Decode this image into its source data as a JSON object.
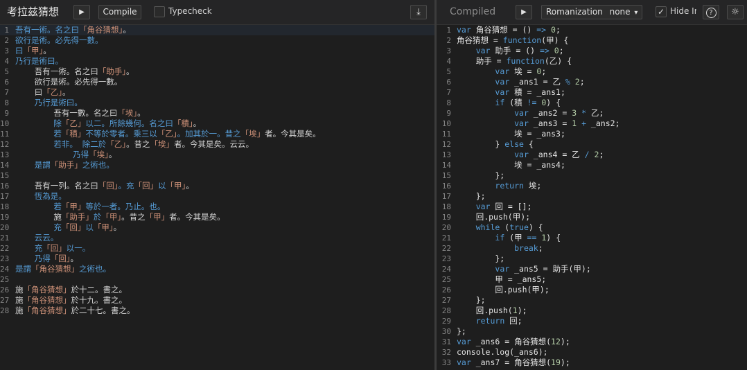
{
  "left": {
    "title": "考拉兹猜想",
    "compile_label": "Compile",
    "typecheck_label": "Typecheck",
    "lines": [
      [
        [
          "吾有一術。名之曰",
          "wy-kw"
        ],
        [
          "「角谷猜想」",
          "wy-str"
        ],
        [
          "。",
          "wy-id"
        ]
      ],
      [
        [
          "欲行是術。必先得一數。",
          "wy-kw"
        ]
      ],
      [
        [
          "曰",
          "wy-kw"
        ],
        [
          "「甲」",
          "wy-str"
        ],
        [
          "。",
          "wy-id"
        ]
      ],
      [
        [
          "乃行是術曰。",
          "wy-kw"
        ]
      ],
      [
        [
          "    吾有一術。名之曰",
          "wy-id"
        ],
        [
          "「助手」",
          "wy-str"
        ],
        [
          "。",
          "wy-id"
        ]
      ],
      [
        [
          "    欲行是術。必先得一數。",
          "wy-id"
        ]
      ],
      [
        [
          "    曰",
          "wy-id"
        ],
        [
          "「乙」",
          "wy-str"
        ],
        [
          "。",
          "wy-id"
        ]
      ],
      [
        [
          "    乃行是術曰。",
          "wy-kw"
        ]
      ],
      [
        [
          "        吾有一數。名之曰",
          "wy-id"
        ],
        [
          "「埃」",
          "wy-str"
        ],
        [
          "。",
          "wy-id"
        ]
      ],
      [
        [
          "        除",
          "wy-kw"
        ],
        [
          "「乙」",
          "wy-str"
        ],
        [
          "以二。所餘幾何。名之曰",
          "wy-kw"
        ],
        [
          "「積」",
          "wy-str"
        ],
        [
          "。",
          "wy-id"
        ]
      ],
      [
        [
          "        若",
          "wy-kw"
        ],
        [
          "「積」",
          "wy-str"
        ],
        [
          "不等於零者。乘三以",
          "wy-kw"
        ],
        [
          "「乙」",
          "wy-str"
        ],
        [
          "。加其於一。昔之",
          "wy-kw"
        ],
        [
          "「埃」",
          "wy-str"
        ],
        [
          "者。今其是矣。",
          "wy-id"
        ]
      ],
      [
        [
          "        若非。 除二於",
          "wy-kw"
        ],
        [
          "「乙」",
          "wy-str"
        ],
        [
          "。昔之",
          "wy-id"
        ],
        [
          "「埃」",
          "wy-str"
        ],
        [
          "者。今其是矣。云云。",
          "wy-id"
        ]
      ],
      [
        [
          "            乃得",
          "wy-kw"
        ],
        [
          "「埃」",
          "wy-str"
        ],
        [
          "。",
          "wy-id"
        ]
      ],
      [
        [
          "    是謂",
          "wy-kw"
        ],
        [
          "「助手」",
          "wy-str"
        ],
        [
          "之術也。",
          "wy-kw"
        ]
      ],
      [
        [
          "",
          "wy-id"
        ]
      ],
      [
        [
          "    吾有一列。名之曰",
          "wy-id"
        ],
        [
          "「回」",
          "wy-str"
        ],
        [
          "。充",
          "wy-kw"
        ],
        [
          "「回」",
          "wy-str"
        ],
        [
          "以",
          "wy-kw"
        ],
        [
          "「甲」",
          "wy-str"
        ],
        [
          "。",
          "wy-id"
        ]
      ],
      [
        [
          "    恆為是。",
          "wy-kw"
        ]
      ],
      [
        [
          "        若",
          "wy-kw"
        ],
        [
          "「甲」",
          "wy-str"
        ],
        [
          "等於一者。乃止。也。",
          "wy-kw"
        ]
      ],
      [
        [
          "        施",
          "wy-id"
        ],
        [
          "「助手」",
          "wy-str"
        ],
        [
          "於",
          "wy-kw"
        ],
        [
          "「甲」",
          "wy-str"
        ],
        [
          "。昔之",
          "wy-id"
        ],
        [
          "「甲」",
          "wy-str"
        ],
        [
          "者。今其是矣。",
          "wy-id"
        ]
      ],
      [
        [
          "        充",
          "wy-kw"
        ],
        [
          "「回」",
          "wy-str"
        ],
        [
          "以",
          "wy-kw"
        ],
        [
          "「甲」",
          "wy-str"
        ],
        [
          "。",
          "wy-id"
        ]
      ],
      [
        [
          "    云云。",
          "wy-kw"
        ]
      ],
      [
        [
          "    充",
          "wy-kw"
        ],
        [
          "「回」",
          "wy-str"
        ],
        [
          "以一。",
          "wy-kw"
        ]
      ],
      [
        [
          "    乃得",
          "wy-kw"
        ],
        [
          "「回」",
          "wy-str"
        ],
        [
          "。",
          "wy-id"
        ]
      ],
      [
        [
          "是謂",
          "wy-kw"
        ],
        [
          "「角谷猜想」",
          "wy-str"
        ],
        [
          "之術也。",
          "wy-kw"
        ]
      ],
      [
        [
          "",
          "wy-id"
        ]
      ],
      [
        [
          "施",
          "wy-id"
        ],
        [
          "「角谷猜想」",
          "wy-str"
        ],
        [
          "於十二。書之。",
          "wy-id"
        ]
      ],
      [
        [
          "施",
          "wy-id"
        ],
        [
          "「角谷猜想」",
          "wy-str"
        ],
        [
          "於十九。書之。",
          "wy-id"
        ]
      ],
      [
        [
          "施",
          "wy-id"
        ],
        [
          "「角谷猜想」",
          "wy-str"
        ],
        [
          "於二十七。書之。",
          "wy-id"
        ]
      ]
    ]
  },
  "right": {
    "title": "Compiled",
    "romanization_label": "Romanization",
    "romanization_value": "none",
    "hide_label": "Hide Ir",
    "lines": [
      [
        [
          "var",
          "kw"
        ],
        [
          " 角谷猜想 = () ",
          "pl"
        ],
        [
          "=>",
          "kw"
        ],
        [
          " ",
          "pl"
        ],
        [
          "0",
          "num"
        ],
        [
          ";",
          "pl"
        ]
      ],
      [
        [
          "角谷猜想 = ",
          "pl"
        ],
        [
          "function",
          "kw"
        ],
        [
          "(甲) {",
          "pl"
        ]
      ],
      [
        [
          "    ",
          "pl"
        ],
        [
          "var",
          "kw"
        ],
        [
          " 助手 = () ",
          "pl"
        ],
        [
          "=>",
          "kw"
        ],
        [
          " ",
          "pl"
        ],
        [
          "0",
          "num"
        ],
        [
          ";",
          "pl"
        ]
      ],
      [
        [
          "    助手 = ",
          "pl"
        ],
        [
          "function",
          "kw"
        ],
        [
          "(乙) {",
          "pl"
        ]
      ],
      [
        [
          "        ",
          "pl"
        ],
        [
          "var",
          "kw"
        ],
        [
          " 埃 = ",
          "pl"
        ],
        [
          "0",
          "num"
        ],
        [
          ";",
          "pl"
        ]
      ],
      [
        [
          "        ",
          "pl"
        ],
        [
          "var",
          "kw"
        ],
        [
          " _ans1 = 乙 ",
          "pl"
        ],
        [
          "%",
          "kw"
        ],
        [
          " ",
          "pl"
        ],
        [
          "2",
          "num"
        ],
        [
          ";",
          "pl"
        ]
      ],
      [
        [
          "        ",
          "pl"
        ],
        [
          "var",
          "kw"
        ],
        [
          " 積 = _ans1;",
          "pl"
        ]
      ],
      [
        [
          "        ",
          "pl"
        ],
        [
          "if",
          "kw"
        ],
        [
          " (積 ",
          "pl"
        ],
        [
          "!=",
          "kw"
        ],
        [
          " ",
          "pl"
        ],
        [
          "0",
          "num"
        ],
        [
          ") {",
          "pl"
        ]
      ],
      [
        [
          "            ",
          "pl"
        ],
        [
          "var",
          "kw"
        ],
        [
          " _ans2 = ",
          "pl"
        ],
        [
          "3",
          "num"
        ],
        [
          " ",
          "pl"
        ],
        [
          "*",
          "kw"
        ],
        [
          " 乙;",
          "pl"
        ]
      ],
      [
        [
          "            ",
          "pl"
        ],
        [
          "var",
          "kw"
        ],
        [
          " _ans3 = ",
          "pl"
        ],
        [
          "1",
          "num"
        ],
        [
          " ",
          "pl"
        ],
        [
          "+",
          "kw"
        ],
        [
          " _ans2;",
          "pl"
        ]
      ],
      [
        [
          "            埃 = _ans3;",
          "pl"
        ]
      ],
      [
        [
          "        } ",
          "pl"
        ],
        [
          "else",
          "kw"
        ],
        [
          " {",
          "pl"
        ]
      ],
      [
        [
          "            ",
          "pl"
        ],
        [
          "var",
          "kw"
        ],
        [
          " _ans4 = 乙 ",
          "pl"
        ],
        [
          "/",
          "kw"
        ],
        [
          " ",
          "pl"
        ],
        [
          "2",
          "num"
        ],
        [
          ";",
          "pl"
        ]
      ],
      [
        [
          "            埃 = _ans4;",
          "pl"
        ]
      ],
      [
        [
          "        };",
          "pl"
        ]
      ],
      [
        [
          "        ",
          "pl"
        ],
        [
          "return",
          "kw"
        ],
        [
          " 埃;",
          "pl"
        ]
      ],
      [
        [
          "    };",
          "pl"
        ]
      ],
      [
        [
          "    ",
          "pl"
        ],
        [
          "var",
          "kw"
        ],
        [
          " 回 = [];",
          "pl"
        ]
      ],
      [
        [
          "    回.push(甲);",
          "pl"
        ]
      ],
      [
        [
          "    ",
          "pl"
        ],
        [
          "while",
          "kw"
        ],
        [
          " (",
          "pl"
        ],
        [
          "true",
          "kw"
        ],
        [
          ") {",
          "pl"
        ]
      ],
      [
        [
          "        ",
          "pl"
        ],
        [
          "if",
          "kw"
        ],
        [
          " (甲 ",
          "pl"
        ],
        [
          "==",
          "kw"
        ],
        [
          " ",
          "pl"
        ],
        [
          "1",
          "num"
        ],
        [
          ") {",
          "pl"
        ]
      ],
      [
        [
          "            ",
          "pl"
        ],
        [
          "break",
          "kw"
        ],
        [
          ";",
          "pl"
        ]
      ],
      [
        [
          "        };",
          "pl"
        ]
      ],
      [
        [
          "        ",
          "pl"
        ],
        [
          "var",
          "kw"
        ],
        [
          " _ans5 = 助手(甲);",
          "pl"
        ]
      ],
      [
        [
          "        甲 = _ans5;",
          "pl"
        ]
      ],
      [
        [
          "        回.push(甲);",
          "pl"
        ]
      ],
      [
        [
          "    };",
          "pl"
        ]
      ],
      [
        [
          "    回.push(",
          "pl"
        ],
        [
          "1",
          "num"
        ],
        [
          ");",
          "pl"
        ]
      ],
      [
        [
          "    ",
          "pl"
        ],
        [
          "return",
          "kw"
        ],
        [
          " 回;",
          "pl"
        ]
      ],
      [
        [
          "};",
          "pl"
        ]
      ],
      [
        [
          "var",
          "kw"
        ],
        [
          " _ans6 = 角谷猜想(",
          "pl"
        ],
        [
          "12",
          "num"
        ],
        [
          ");",
          "pl"
        ]
      ],
      [
        [
          "console.log(_ans6);",
          "pl"
        ]
      ],
      [
        [
          "var",
          "kw"
        ],
        [
          " _ans7 = 角谷猜想(",
          "pl"
        ],
        [
          "19",
          "num"
        ],
        [
          ");",
          "pl"
        ]
      ]
    ]
  },
  "icons": {
    "play": "▶",
    "download": "⤓",
    "help": "?",
    "theme": "☼",
    "check": "✓",
    "dropdown": "▾"
  }
}
